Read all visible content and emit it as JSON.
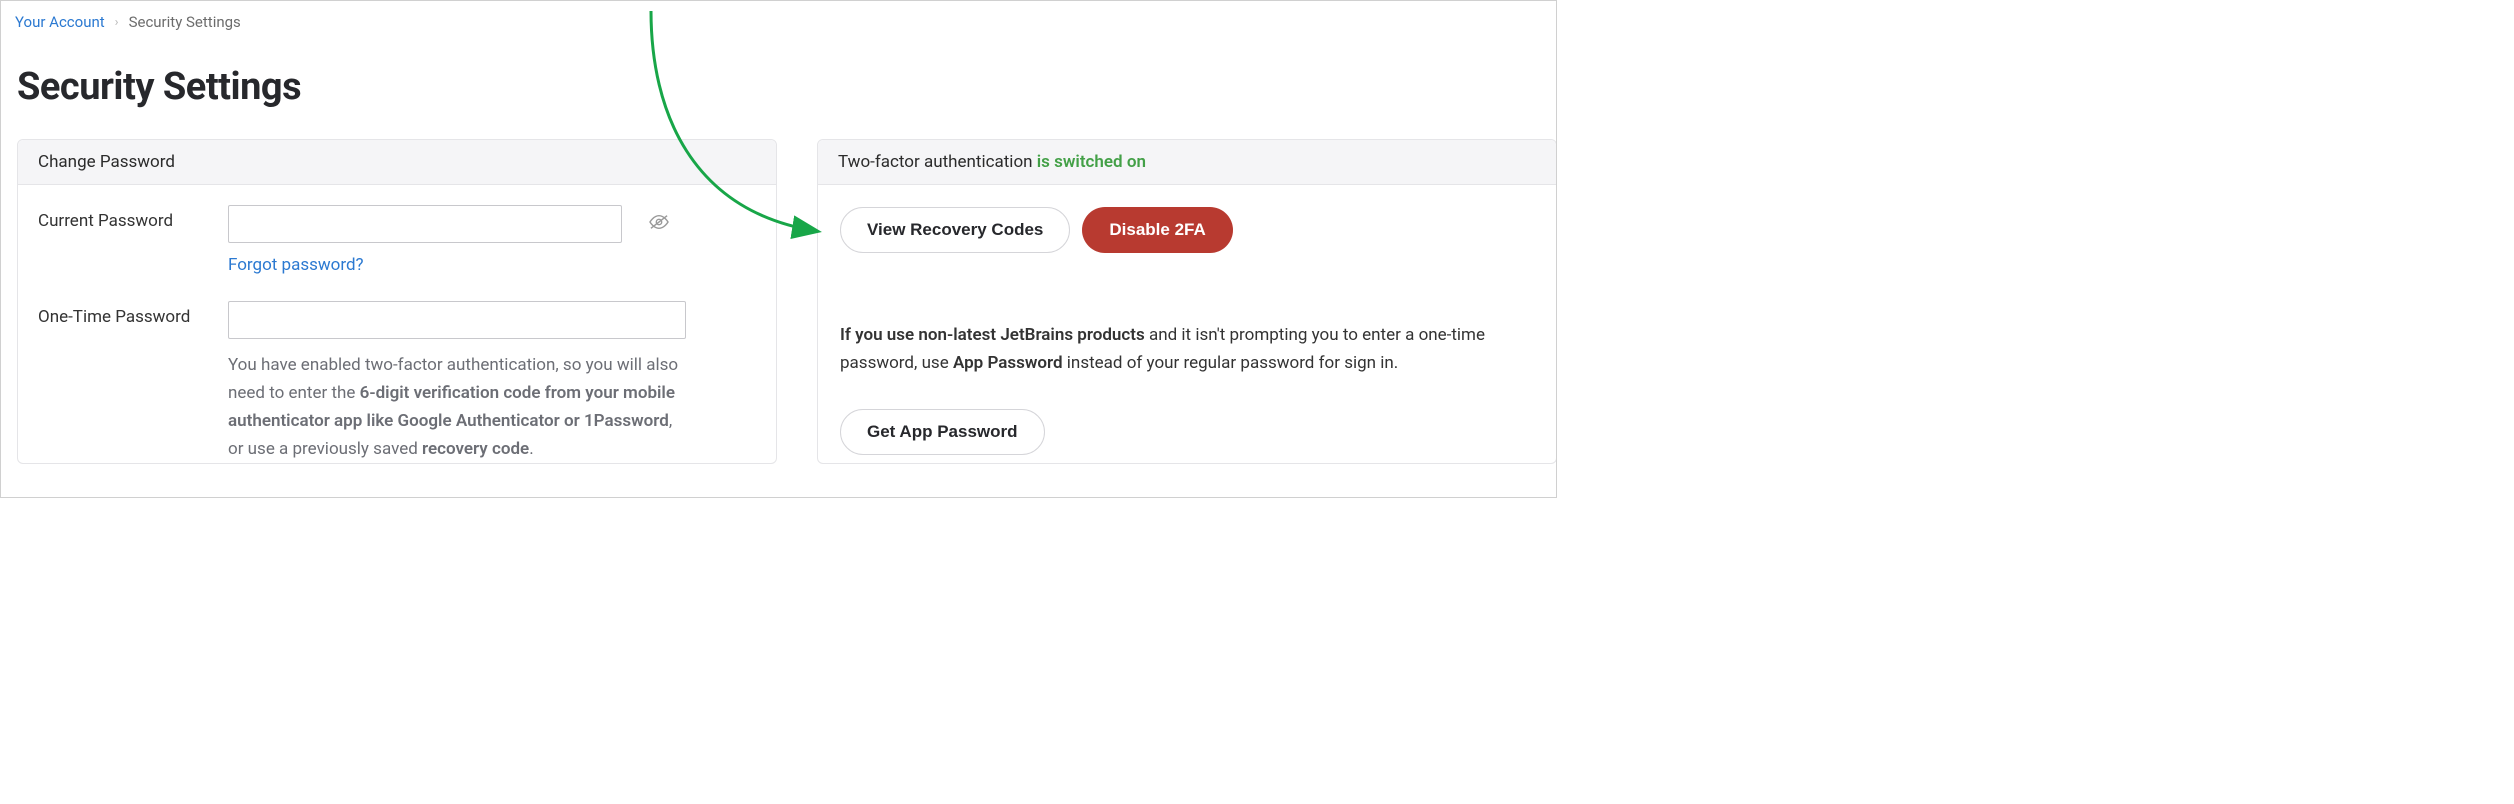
{
  "breadcrumb": {
    "root": "Your Account",
    "current": "Security Settings"
  },
  "page_title": "Security Settings",
  "left_panel": {
    "header": "Change Password",
    "current_password_label": "Current Password",
    "forgot_link": "Forgot password?",
    "otp_label": "One-Time Password",
    "help_prefix": "You have enabled two-factor authentication, so you will also need to enter the ",
    "help_bold1": "6-digit verification code from your mobile authenticator app like Google Authenticator or 1Password",
    "help_mid": ", or use a previously saved ",
    "help_bold2": "recovery code",
    "help_suffix": "."
  },
  "right_panel": {
    "header_prefix": "Two-factor authentication ",
    "header_status": "is switched on",
    "view_recovery": "View Recovery Codes",
    "disable_2fa": "Disable 2FA",
    "info_bold1": "If you use non-latest JetBrains products",
    "info_mid1": " and it isn't prompting you to enter a one-time password, use ",
    "info_bold2": "App Password",
    "info_mid2": " instead of your regular password for sign in.",
    "get_app_password": "Get App Password"
  }
}
